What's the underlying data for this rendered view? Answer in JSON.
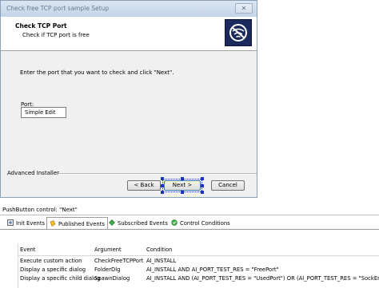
{
  "window": {
    "title": "Check free TCP port sample Setup",
    "close_glyph": "✕",
    "header_title": "Check TCP Port",
    "header_subtitle": "Check if TCP port is free",
    "instruction": "Enter the port that you want to check and click \"Next\".",
    "port_label": "Port:",
    "port_value": "Simple Edit",
    "brand": "Advanced Installer",
    "buttons": {
      "back": "< Back",
      "next": "Next >",
      "cancel": "Cancel"
    }
  },
  "properties": {
    "caption": "PushButton control: \"Next\"",
    "tabs": [
      {
        "label": "Init Events",
        "icon": "init-events-icon"
      },
      {
        "label": "Published Events",
        "icon": "published-events-icon"
      },
      {
        "label": "Subscribed Events",
        "icon": "subscribed-events-icon"
      },
      {
        "label": "Control Conditions",
        "icon": "control-conditions-icon"
      }
    ],
    "columns": [
      "Event",
      "Argument",
      "Condition"
    ],
    "rows": [
      [
        "Execute custom action",
        "CheckFreeTCPPort",
        "AI_INSTALL"
      ],
      [
        "Display a specific dialog",
        "FolderDlg",
        "AI_INSTALL AND AI_PORT_TEST_RES = \"FreePort\""
      ],
      [
        "Display a specific child dialog",
        "SpawnDialog",
        "AI_INSTALL AND (AI_PORT_TEST_RES = \"UsedPort\") OR (AI_PORT_TEST_RES = \"SockError\")"
      ]
    ]
  },
  "colors": {
    "logo_bg": "#1b2a5c",
    "selection": "#1c33c9"
  }
}
